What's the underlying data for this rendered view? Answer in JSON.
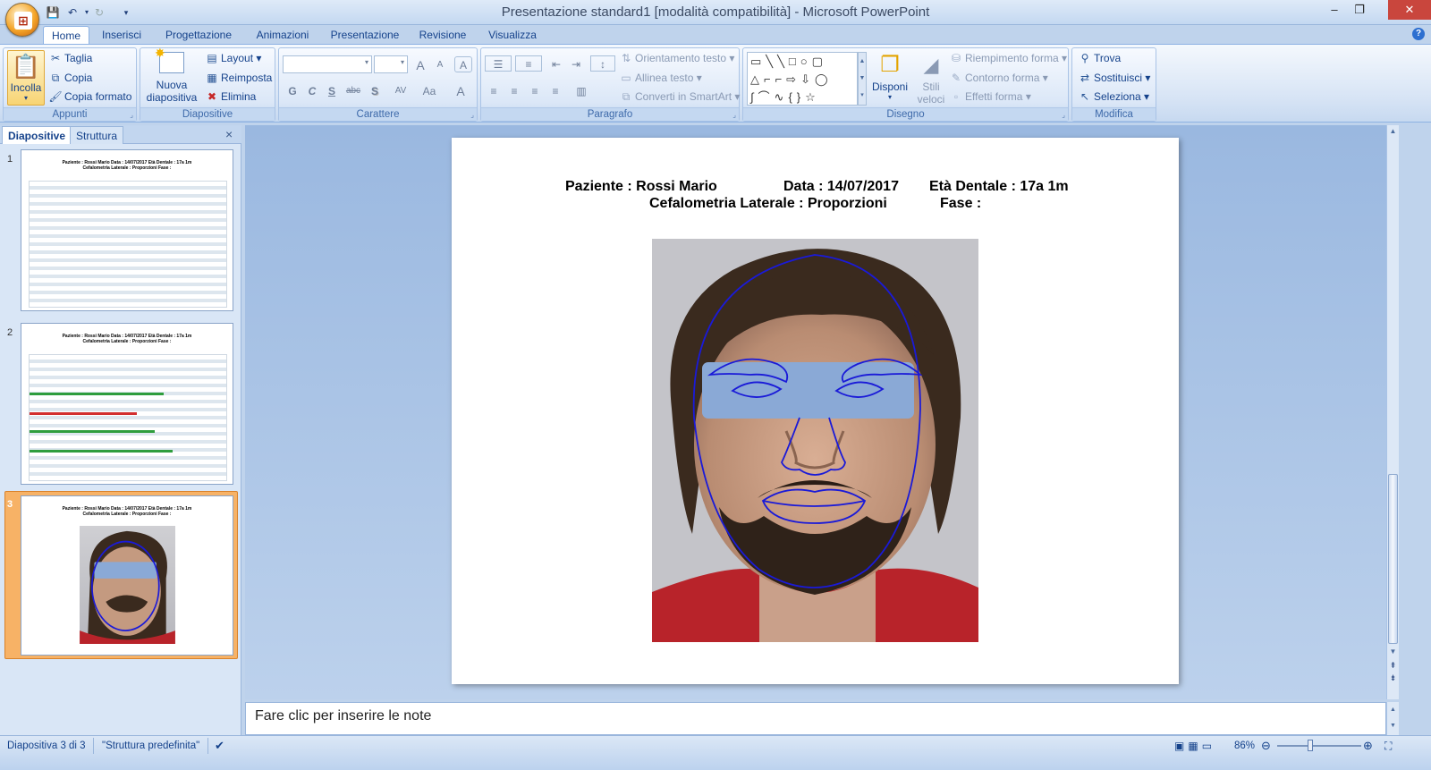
{
  "window": {
    "title": "Presentazione standard1 [modalità compatibilità] - Microsoft PowerPoint",
    "minimize": "–",
    "restore": "❐",
    "close": "✕"
  },
  "ribbon_tabs": [
    "Home",
    "Inserisci",
    "Progettazione",
    "Animazioni",
    "Presentazione",
    "Revisione",
    "Visualizza"
  ],
  "groups": {
    "appunti": {
      "label": "Appunti",
      "paste": "Incolla",
      "cut": "Taglia",
      "copy": "Copia",
      "format_painter": "Copia formato"
    },
    "diapositive": {
      "label": "Diapositive",
      "new_slide_1": "Nuova",
      "new_slide_2": "diapositiva",
      "layout": "Layout",
      "reset": "Reimposta",
      "delete": "Elimina"
    },
    "carattere": {
      "label": "Carattere",
      "bold": "G",
      "italic": "C",
      "underline": "S",
      "strike": "abc",
      "shadow": "S",
      "spacing": "AV",
      "case": "Aa",
      "grow": "A",
      "shrink": "A",
      "clear": "A",
      "color": "A"
    },
    "paragrafo": {
      "label": "Paragrafo",
      "text_direction": "Orientamento testo",
      "align_text": "Allinea testo",
      "smartart": "Converti in SmartArt"
    },
    "disegno": {
      "label": "Disegno",
      "arrange": "Disponi",
      "styles_1": "Stili",
      "styles_2": "veloci",
      "shape_fill": "Riempimento forma",
      "shape_outline": "Contorno forma",
      "shape_effects": "Effetti forma"
    },
    "modifica": {
      "label": "Modifica",
      "find": "Trova",
      "replace": "Sostituisci",
      "select": "Seleziona"
    }
  },
  "left_panel": {
    "tab_slides": "Diapositive",
    "tab_outline": "Struttura",
    "close": "×",
    "slides": [
      {
        "num": "1"
      },
      {
        "num": "2"
      },
      {
        "num": "3"
      }
    ],
    "thumb_header_1": "Paziente : Rossi Mario          Data : 14/07/2017     Età Dentale : 17a 1m",
    "thumb_header_2": "Cefalometria Laterale : Proporzioni          Fase :"
  },
  "slide": {
    "patient": "Paziente : Rossi Mario",
    "date": "Data : 14/07/2017",
    "dental_age": "Età Dentale : 17a 1m",
    "analysis": "Cefalometria Laterale : Proporzioni",
    "phase": "Fase :"
  },
  "notes": {
    "placeholder": "Fare clic per inserire le note"
  },
  "status": {
    "slide_info": "Diapositiva 3 di 3",
    "theme": "\"Struttura predefinita\"",
    "zoom": "86%"
  },
  "colors": {
    "overlay": "#8aa9d6",
    "trace": "#1a1ad8",
    "selection": "#f7b266"
  }
}
